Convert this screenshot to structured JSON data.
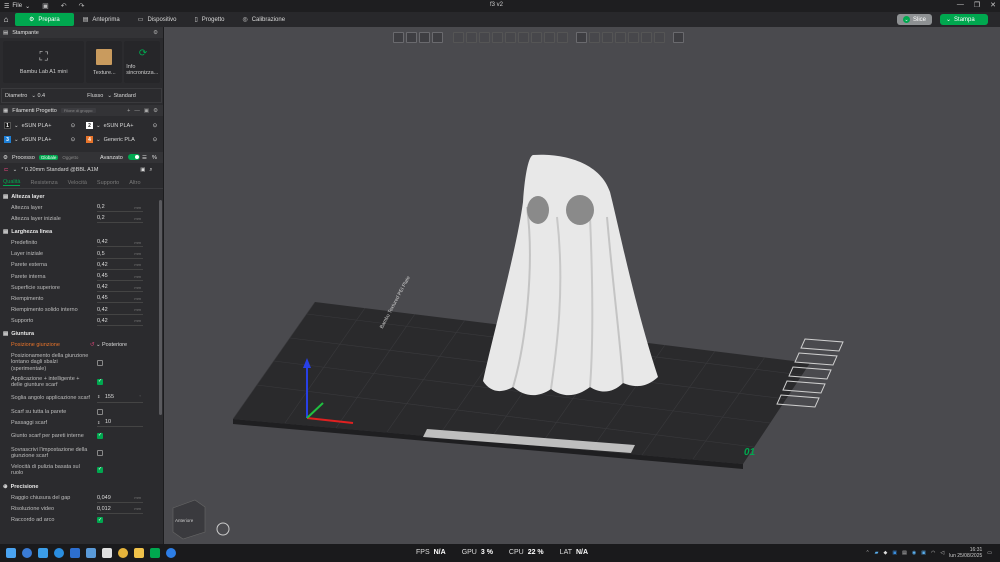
{
  "titlebar": {
    "file_label": "File",
    "window_title": "f3 v2"
  },
  "menu": {
    "tabs": [
      {
        "label": "Prepara"
      },
      {
        "label": "Anteprima"
      },
      {
        "label": "Dispositivo"
      },
      {
        "label": "Progetto"
      },
      {
        "label": "Calibrazione"
      }
    ],
    "slice_label": "Slice",
    "print_label": "Stampa"
  },
  "printer": {
    "section_title": "Stampante",
    "printer_name": "Bambu Lab A1 mini",
    "plate_label": "Texture...",
    "sync_label": "Info sincronizza...",
    "diameter_label": "Diametro",
    "diameter_value": "0.4",
    "flow_label": "Flusso",
    "flow_value": "Standard"
  },
  "filaments": {
    "section_title": "Filamenti Progetto",
    "group_label": "Filone di gruppo",
    "items": [
      {
        "num": "1",
        "name": "eSUN PLA+",
        "color": "#1a1a1a"
      },
      {
        "num": "2",
        "name": "eSUN PLA+",
        "color": "#ffffff"
      },
      {
        "num": "3",
        "name": "eSUN PLA+",
        "color": "#1e7fd6"
      },
      {
        "num": "4",
        "name": "Generic PLA",
        "color": "#e8742a"
      }
    ]
  },
  "process": {
    "title": "Processo",
    "global_label": "Globale",
    "object_label": "Oggetto",
    "advanced_label": "Avanzato",
    "profile": "* 0.20mm Standard @BBL A1M",
    "tabs": [
      "Qualità",
      "Resistenza",
      "Velocità",
      "Supporto",
      "Altro"
    ]
  },
  "quality": {
    "layer_height": {
      "title": "Altezza layer",
      "rows": [
        {
          "label": "Altezza layer",
          "value": "0,2",
          "unit": "mm"
        },
        {
          "label": "Altezza layer iniziale",
          "value": "0,2",
          "unit": "mm"
        }
      ]
    },
    "line_width": {
      "title": "Larghezza linea",
      "rows": [
        {
          "label": "Predefinito",
          "value": "0,42",
          "unit": "mm"
        },
        {
          "label": "Layer iniziale",
          "value": "0,5",
          "unit": "mm"
        },
        {
          "label": "Parete esterna",
          "value": "0,42",
          "unit": "mm"
        },
        {
          "label": "Parete interna",
          "value": "0,45",
          "unit": "mm"
        },
        {
          "label": "Superficie superiore",
          "value": "0,42",
          "unit": "mm"
        },
        {
          "label": "Riempimento",
          "value": "0,45",
          "unit": "mm"
        },
        {
          "label": "Riempimento solido interno",
          "value": "0,42",
          "unit": "mm"
        },
        {
          "label": "Supporto",
          "value": "0,42",
          "unit": "mm"
        }
      ]
    },
    "seam": {
      "title": "Giuntura",
      "position_label": "Posizione giunzione",
      "position_value": "Posteriore",
      "staggered_label": "Posizionamento della giunzione lontano dagli sbalzi (sperimentale)",
      "scarf_apply_label": "Applicazione + intelligente + delle giunture scarf",
      "scarf_angle_label": "Soglia angolo applicazione scarf",
      "scarf_angle_value": "155",
      "scarf_angle_unit": "°",
      "scarf_all_label": "Scarf su tutta la parete",
      "scarf_steps_label": "Passaggi scarf",
      "scarf_steps_value": "10",
      "scarf_inner_label": "Giunto scarf per pareti interne",
      "override_label": "Sovrascrivi l'impostazione della giunzione scarf",
      "wipe_speed_label": "Velocità di pulizia basata sul ruolo"
    },
    "precision": {
      "title": "Precisione",
      "rows": [
        {
          "label": "Raggio chiusura del gap",
          "value": "0,049",
          "unit": "mm"
        },
        {
          "label": "Risoluzione video",
          "value": "0,012",
          "unit": "mm"
        }
      ],
      "arc_label": "Raccordo ad arco"
    }
  },
  "viewport": {
    "view_cube_label": "Anteriore",
    "plate_number": "01",
    "plate_text": "Bambu Textured PEI Plate"
  },
  "taskbar": {
    "fps_label": "FPS",
    "fps_value": "N/A",
    "gpu_label": "GPU",
    "gpu_value": "3 %",
    "cpu_label": "CPU",
    "cpu_value": "22 %",
    "lat_label": "LAT",
    "lat_value": "N/A",
    "time": "16:31",
    "date": "lun 25/08/2025"
  }
}
